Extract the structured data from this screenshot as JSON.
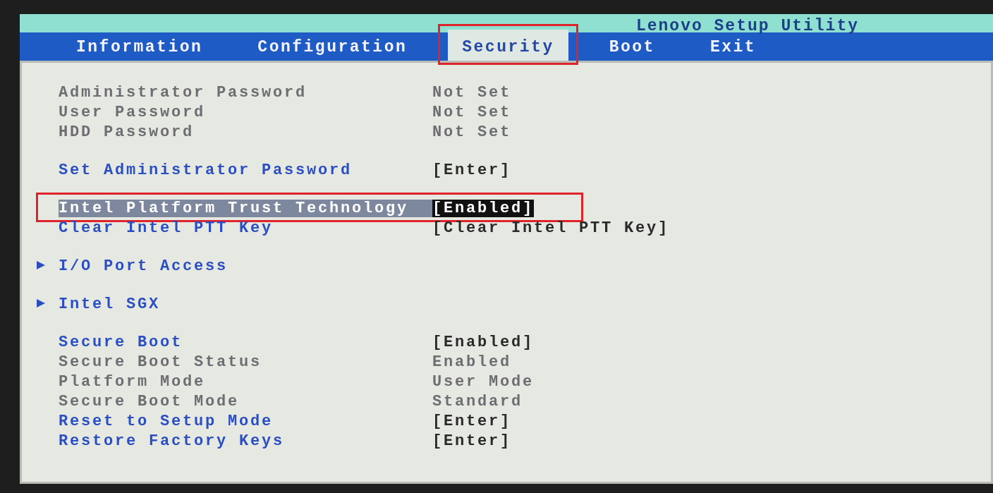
{
  "header": {
    "title": "Lenovo Setup Utility"
  },
  "tabs": [
    {
      "label": "Information",
      "selected": false,
      "annotated": false
    },
    {
      "label": "Configuration",
      "selected": false,
      "annotated": false
    },
    {
      "label": "Security",
      "selected": true,
      "annotated": true
    },
    {
      "label": "Boot",
      "selected": false,
      "annotated": false
    },
    {
      "label": "Exit",
      "selected": false,
      "annotated": false
    }
  ],
  "sections": [
    {
      "rows": [
        {
          "kind": "info",
          "label": "Administrator Password",
          "value": "Not Set"
        },
        {
          "kind": "info",
          "label": "User Password",
          "value": "Not Set"
        },
        {
          "kind": "info",
          "label": "HDD Password",
          "value": "Not Set"
        }
      ]
    },
    {
      "rows": [
        {
          "kind": "setting",
          "label": "Set Administrator Password",
          "value": "[Enter]",
          "selected": false,
          "annotated": false
        }
      ]
    },
    {
      "rows": [
        {
          "kind": "setting",
          "label": "Intel Platform Trust Technology",
          "value": "[Enabled]",
          "selected": true,
          "annotated": true
        },
        {
          "kind": "setting",
          "label": "Clear Intel PTT Key",
          "value": "[Clear Intel PTT Key]",
          "selected": false,
          "annotated": false
        }
      ]
    },
    {
      "rows": [
        {
          "kind": "submenu",
          "label": "I/O Port Access"
        }
      ]
    },
    {
      "rows": [
        {
          "kind": "submenu",
          "label": "Intel SGX"
        }
      ]
    },
    {
      "rows": [
        {
          "kind": "setting",
          "label": "Secure Boot",
          "value": "[Enabled]",
          "selected": false,
          "annotated": false
        },
        {
          "kind": "info",
          "label": "Secure Boot Status",
          "value": "Enabled"
        },
        {
          "kind": "info",
          "label": "Platform Mode",
          "value": "User Mode"
        },
        {
          "kind": "info",
          "label": "Secure Boot Mode",
          "value": "Standard"
        },
        {
          "kind": "setting",
          "label": "Reset to Setup Mode",
          "value": "[Enter]",
          "selected": false,
          "annotated": false
        },
        {
          "kind": "setting",
          "label": "Restore Factory Keys",
          "value": "[Enter]",
          "selected": false,
          "annotated": false
        }
      ]
    }
  ]
}
